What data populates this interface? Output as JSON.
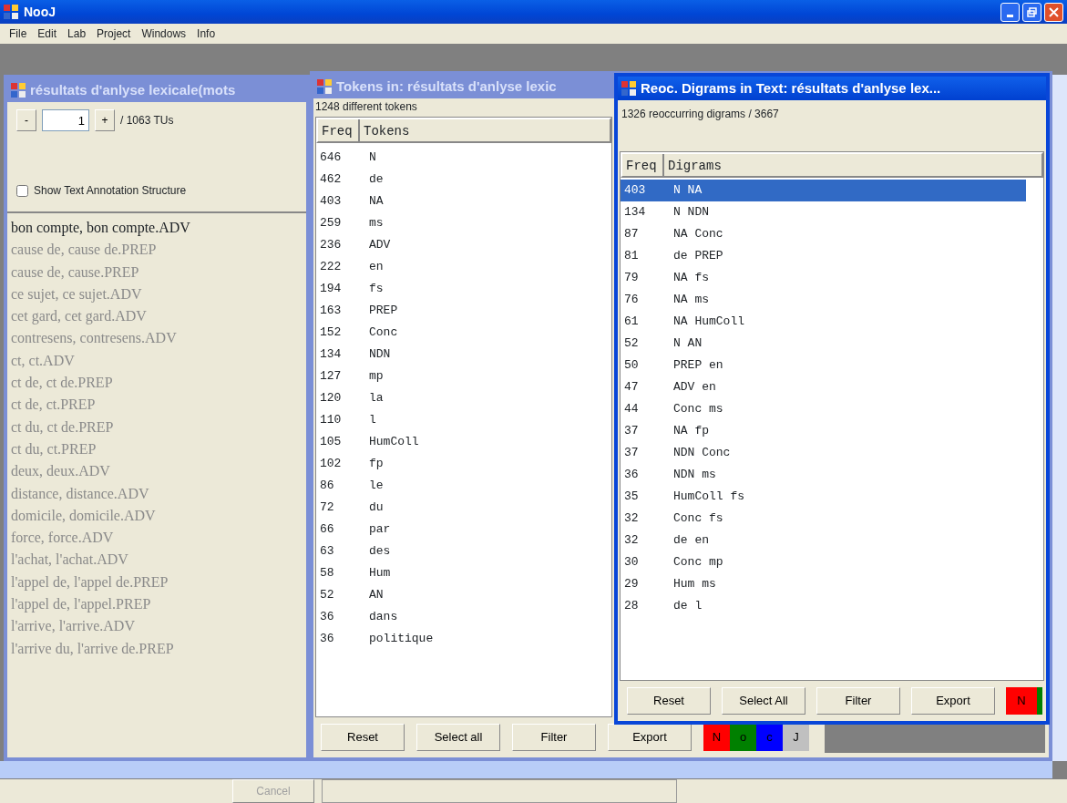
{
  "app": {
    "title": "NooJ"
  },
  "menu": [
    "File",
    "Edit",
    "Lab",
    "Project",
    "Windows",
    "Info"
  ],
  "text_window": {
    "title": "résultats d'anlyse lexicale(mots",
    "minus": "-",
    "unit_number": "1",
    "plus": "+",
    "unit_count": "/ 1063 TUs",
    "show_structure": {
      "label": "Show Text Annotation Structure",
      "checked": false
    },
    "units": [
      {
        "text": "bon compte, bon compte.ADV",
        "selected": true
      },
      {
        "text": "cause de, cause de.PREP",
        "selected": false
      },
      {
        "text": "cause de, cause.PREP",
        "selected": false
      },
      {
        "text": "ce sujet, ce sujet.ADV",
        "selected": false
      },
      {
        "text": "cet gard, cet gard.ADV",
        "selected": false
      },
      {
        "text": "contresens, contresens.ADV",
        "selected": false
      },
      {
        "text": "ct, ct.ADV",
        "selected": false
      },
      {
        "text": "ct de, ct de.PREP",
        "selected": false
      },
      {
        "text": "ct de, ct.PREP",
        "selected": false
      },
      {
        "text": "ct du, ct de.PREP",
        "selected": false
      },
      {
        "text": "ct du, ct.PREP",
        "selected": false
      },
      {
        "text": "deux, deux.ADV",
        "selected": false
      },
      {
        "text": "distance, distance.ADV",
        "selected": false
      },
      {
        "text": "domicile, domicile.ADV",
        "selected": false
      },
      {
        "text": "force, force.ADV",
        "selected": false
      },
      {
        "text": "l'achat, l'achat.ADV",
        "selected": false
      },
      {
        "text": "l'appel de, l'appel de.PREP",
        "selected": false
      },
      {
        "text": "l'appel de, l'appel.PREP",
        "selected": false
      },
      {
        "text": "l'arrive, l'arrive.ADV",
        "selected": false
      },
      {
        "text": "l'arrive du, l'arrive de.PREP",
        "selected": false
      }
    ]
  },
  "tokens_window": {
    "title": "Tokens in: résultats d'anlyse lexic",
    "summary": "1248 different tokens",
    "columns": [
      "Freq",
      "Tokens"
    ],
    "rows": [
      {
        "freq": "646",
        "item": "N"
      },
      {
        "freq": "462",
        "item": "de"
      },
      {
        "freq": "403",
        "item": "NA"
      },
      {
        "freq": "259",
        "item": "ms"
      },
      {
        "freq": "236",
        "item": "ADV"
      },
      {
        "freq": "222",
        "item": "en"
      },
      {
        "freq": "194",
        "item": "fs"
      },
      {
        "freq": "163",
        "item": "PREP"
      },
      {
        "freq": "152",
        "item": "Conc"
      },
      {
        "freq": "134",
        "item": "NDN"
      },
      {
        "freq": "127",
        "item": "mp"
      },
      {
        "freq": "120",
        "item": "la"
      },
      {
        "freq": "110",
        "item": "l"
      },
      {
        "freq": "105",
        "item": "HumColl"
      },
      {
        "freq": "102",
        "item": "fp"
      },
      {
        "freq": "86",
        "item": "le"
      },
      {
        "freq": "72",
        "item": "du"
      },
      {
        "freq": "66",
        "item": "par"
      },
      {
        "freq": "63",
        "item": "des"
      },
      {
        "freq": "58",
        "item": "Hum"
      },
      {
        "freq": "52",
        "item": "AN"
      },
      {
        "freq": "36",
        "item": "dans"
      },
      {
        "freq": "36",
        "item": "politique"
      }
    ],
    "buttons": [
      "Reset",
      "Select all",
      "Filter",
      "Export"
    ],
    "color_keys": [
      {
        "label": "N",
        "color": "#ff0000"
      },
      {
        "label": "o",
        "color": "#008000"
      },
      {
        "label": "c",
        "color": "#0000ff"
      },
      {
        "label": "J",
        "color": "#c0c0c0"
      }
    ]
  },
  "digrams_window": {
    "title": "Reoc. Digrams in Text: résultats d'anlyse lex...",
    "summary": "1326 reoccurring digrams / 3667",
    "columns": [
      "Freq",
      "Digrams"
    ],
    "rows": [
      {
        "freq": "403",
        "item": "N NA",
        "selected": true
      },
      {
        "freq": "134",
        "item": "N NDN",
        "selected": false
      },
      {
        "freq": "87",
        "item": "NA Conc",
        "selected": false
      },
      {
        "freq": "81",
        "item": "de PREP",
        "selected": false
      },
      {
        "freq": "79",
        "item": "NA fs",
        "selected": false
      },
      {
        "freq": "76",
        "item": "NA ms",
        "selected": false
      },
      {
        "freq": "61",
        "item": "NA HumColl",
        "selected": false
      },
      {
        "freq": "52",
        "item": "N AN",
        "selected": false
      },
      {
        "freq": "50",
        "item": "PREP en",
        "selected": false
      },
      {
        "freq": "47",
        "item": "ADV en",
        "selected": false
      },
      {
        "freq": "44",
        "item": "Conc ms",
        "selected": false
      },
      {
        "freq": "37",
        "item": "NA fp",
        "selected": false
      },
      {
        "freq": "37",
        "item": "NDN Conc",
        "selected": false
      },
      {
        "freq": "36",
        "item": "NDN ms",
        "selected": false
      },
      {
        "freq": "35",
        "item": "HumColl fs",
        "selected": false
      },
      {
        "freq": "32",
        "item": "Conc fs",
        "selected": false
      },
      {
        "freq": "32",
        "item": "de en",
        "selected": false
      },
      {
        "freq": "30",
        "item": "Conc mp",
        "selected": false
      },
      {
        "freq": "29",
        "item": "Hum ms",
        "selected": false
      },
      {
        "freq": "28",
        "item": "de l",
        "selected": false
      }
    ],
    "buttons": [
      "Reset",
      "Select All",
      "Filter",
      "Export"
    ],
    "color_keys": [
      {
        "label": "N",
        "color": "#ff0000"
      },
      {
        "color": "#008000"
      }
    ]
  },
  "status_bar": {
    "cancel": {
      "label": "Cancel",
      "disabled": true
    }
  }
}
